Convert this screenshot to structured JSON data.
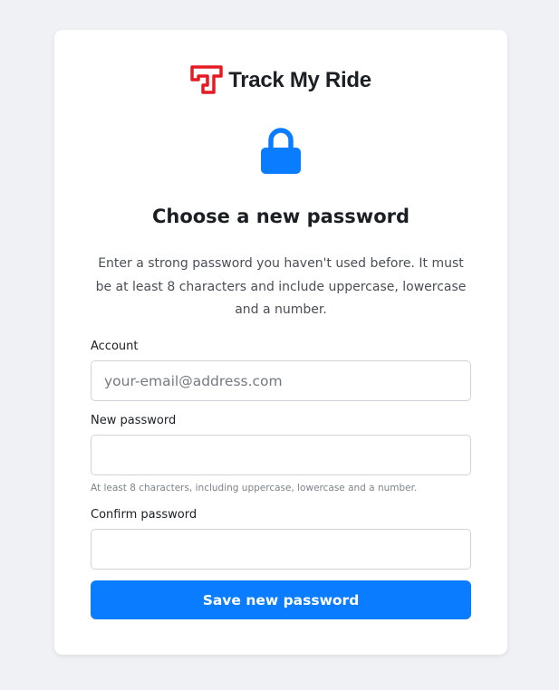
{
  "brand": {
    "name": "Track My Ride",
    "logo_icon": "track-my-ride-logo",
    "logo_color": "#e41b23"
  },
  "hero": {
    "icon": "lock-icon",
    "icon_color": "#0a7cff"
  },
  "title": "Choose a new password",
  "description": "Enter a strong password you haven't used before. It must be at least 8 characters and include uppercase, lowercase and a number.",
  "form": {
    "account": {
      "label": "Account",
      "placeholder": "your-email@address.com",
      "value": ""
    },
    "new_password": {
      "label": "New password",
      "value": "",
      "hint": "At least 8 characters, including uppercase, lowercase and a number."
    },
    "confirm_password": {
      "label": "Confirm password",
      "value": ""
    },
    "submit_label": "Save new password"
  },
  "colors": {
    "accent": "#0a7cff",
    "background": "#eff1f5",
    "card": "#ffffff"
  }
}
